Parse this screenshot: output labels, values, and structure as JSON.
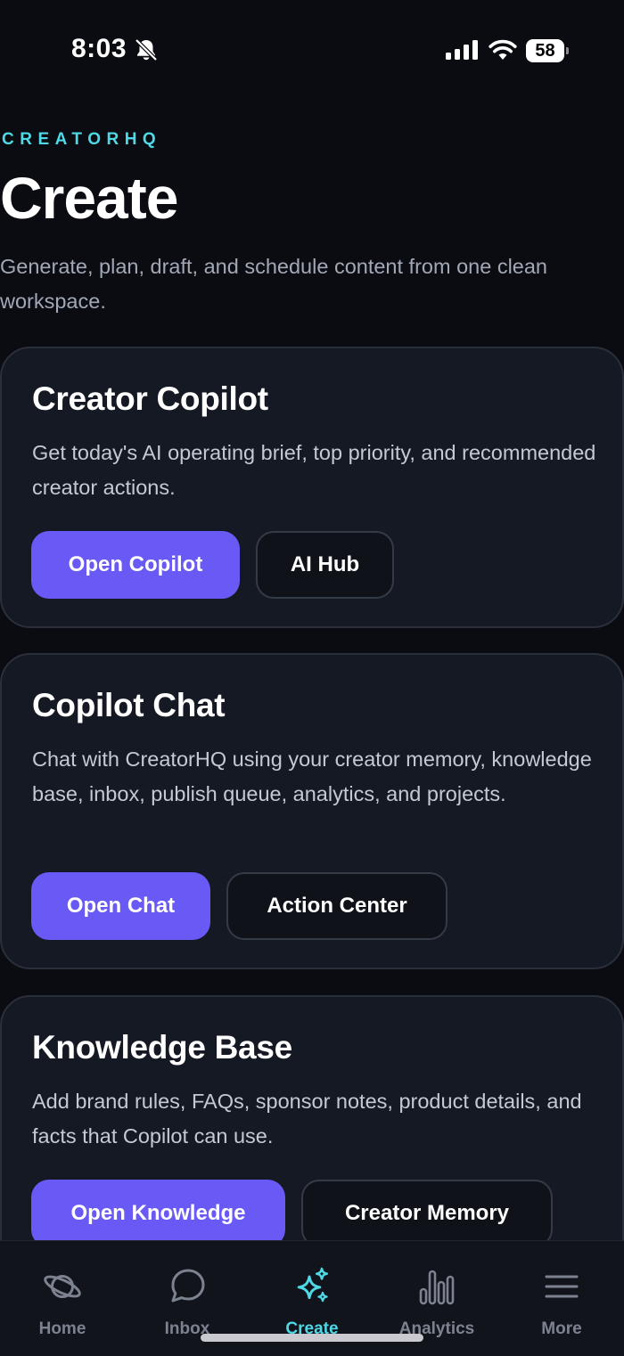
{
  "status_bar": {
    "time": "8:03",
    "battery_percent": "58",
    "icons": [
      "bell-slash-icon",
      "cellular-signal-icon",
      "wifi-icon",
      "battery-icon"
    ]
  },
  "header": {
    "brand": "CREATORHQ",
    "title": "Create",
    "subtitle": "Generate, plan, draft, and schedule content from one clean workspace."
  },
  "cards": [
    {
      "title": "Creator Copilot",
      "description": "Get today's AI operating brief, top priority, and recommended creator actions.",
      "primary_label": "Open Copilot",
      "secondary_label": "AI Hub"
    },
    {
      "title": "Copilot Chat",
      "description": "Chat with CreatorHQ using your creator memory, knowledge base, inbox, publish queue, analytics, and projects.",
      "primary_label": "Open Chat",
      "secondary_label": "Action Center"
    },
    {
      "title": "Knowledge Base",
      "description": "Add brand rules, FAQs, sponsor notes, product details, and facts that Copilot can use.",
      "primary_label": "Open Knowledge",
      "secondary_label": "Creator Memory"
    }
  ],
  "tab_bar": {
    "active_tab": "Create",
    "accent_color": "#4fd8e6",
    "tabs": [
      {
        "label": "Home",
        "icon": "planet-icon"
      },
      {
        "label": "Inbox",
        "icon": "chat-bubble-icon"
      },
      {
        "label": "Create",
        "icon": "sparkles-icon"
      },
      {
        "label": "Analytics",
        "icon": "bar-chart-icon"
      },
      {
        "label": "More",
        "icon": "menu-icon"
      }
    ]
  },
  "colors": {
    "background": "#0a0c11",
    "card": "#151924",
    "primary_button": "#6a5af5",
    "brand": "#4fd8e6"
  }
}
